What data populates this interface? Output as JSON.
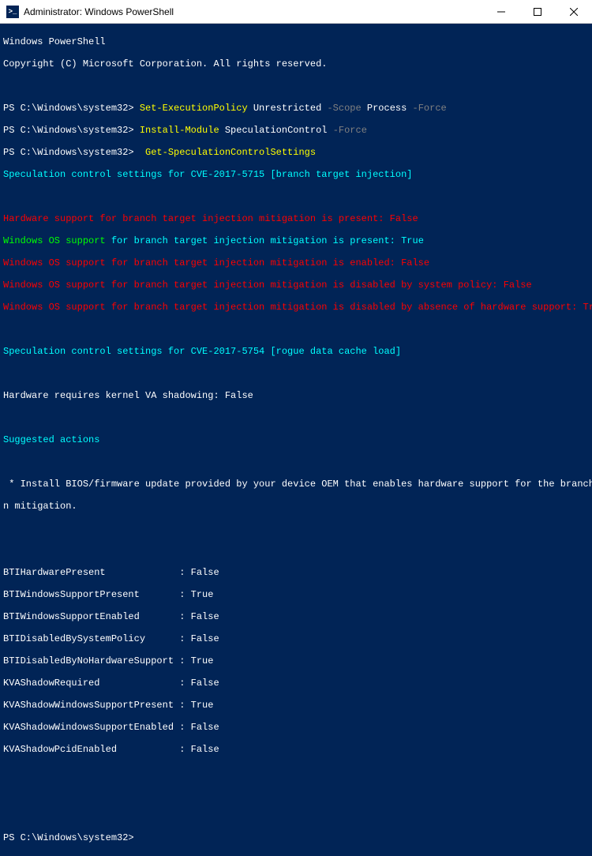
{
  "window": {
    "title": "Administrator: Windows PowerShell",
    "icon_label": ">_"
  },
  "header": {
    "line1": "Windows PowerShell",
    "line2": "Copyright (C) Microsoft Corporation. All rights reserved."
  },
  "cmds": {
    "prompt": "PS C:\\Windows\\system32> ",
    "c1": {
      "cmd": "Set-ExecutionPolicy",
      "arg": " Unrestricted ",
      "p1": "-Scope",
      "v1": " Process ",
      "p2": "-Force"
    },
    "c2": {
      "cmd": "Install-Module",
      "arg": " SpeculationControl ",
      "p1": "-Force"
    },
    "c3": {
      "pre": " ",
      "cmd": "Get-SpeculationControlSettings"
    }
  },
  "out": {
    "s1": "Speculation control settings for CVE-2017-5715 [branch target injection]",
    "r1": "Hardware support for branch target injection mitigation is present: False",
    "g1a": "Windows OS support ",
    "g1b": "for branch target injection mitigation is present: True",
    "r2": "Windows OS support for branch target injection mitigation is enabled: False",
    "r3": "Windows OS support for branch target injection mitigation is disabled by system policy: False",
    "r4": "Windows OS support for branch target injection mitigation is disabled by absence of hardware support: True",
    "s2": "Speculation control settings for CVE-2017-5754 [rogue data cache load]",
    "w1": "Hardware requires kernel VA shadowing: False",
    "s3": "Suggested actions",
    "w2a": " * Install BIOS/firmware update provided by your device OEM that enables hardware support for the branch target injectio",
    "w2b": "n mitigation."
  },
  "props": {
    "p0": {
      "k": "BTIHardwarePresent             ",
      "v": ": False"
    },
    "p1": {
      "k": "BTIWindowsSupportPresent       ",
      "v": ": True"
    },
    "p2": {
      "k": "BTIWindowsSupportEnabled       ",
      "v": ": False"
    },
    "p3": {
      "k": "BTIDisabledBySystemPolicy      ",
      "v": ": False"
    },
    "p4": {
      "k": "BTIDisabledByNoHardwareSupport ",
      "v": ": True"
    },
    "p5": {
      "k": "KVAShadowRequired              ",
      "v": ": False"
    },
    "p6": {
      "k": "KVAShadowWindowsSupportPresent ",
      "v": ": True"
    },
    "p7": {
      "k": "KVAShadowWindowsSupportEnabled ",
      "v": ": False"
    },
    "p8": {
      "k": "KVAShadowPcidEnabled           ",
      "v": ": False"
    }
  },
  "final_prompt": "PS C:\\Windows\\system32>"
}
